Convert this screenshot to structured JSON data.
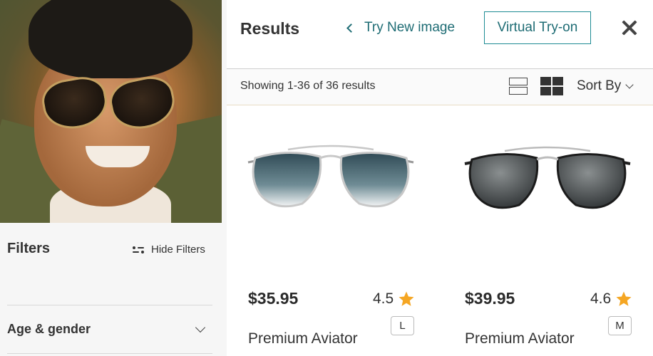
{
  "left": {
    "photo_alt": "man-wearing-aviator-sunglasses",
    "filters_title": "Filters",
    "hide_filters_label": "Hide Filters",
    "age_gender_label": "Age & gender"
  },
  "header": {
    "title": "Results",
    "try_new_label": "Try New image",
    "virtual_tryon_label": "Virtual Try-on",
    "accent_color": "#1e6c74"
  },
  "toolbar": {
    "showing_text": "Showing 1-36 of 36 results",
    "sort_label": "Sort By"
  },
  "products": [
    {
      "price": "$35.95",
      "rating": "4.5",
      "size": "L",
      "name": "Premium Aviator",
      "lens_style": "gradient-teal",
      "frame": "silver"
    },
    {
      "price": "$39.95",
      "rating": "4.6",
      "size": "M",
      "name": "Premium Aviator",
      "lens_style": "gray",
      "frame": "black"
    }
  ]
}
